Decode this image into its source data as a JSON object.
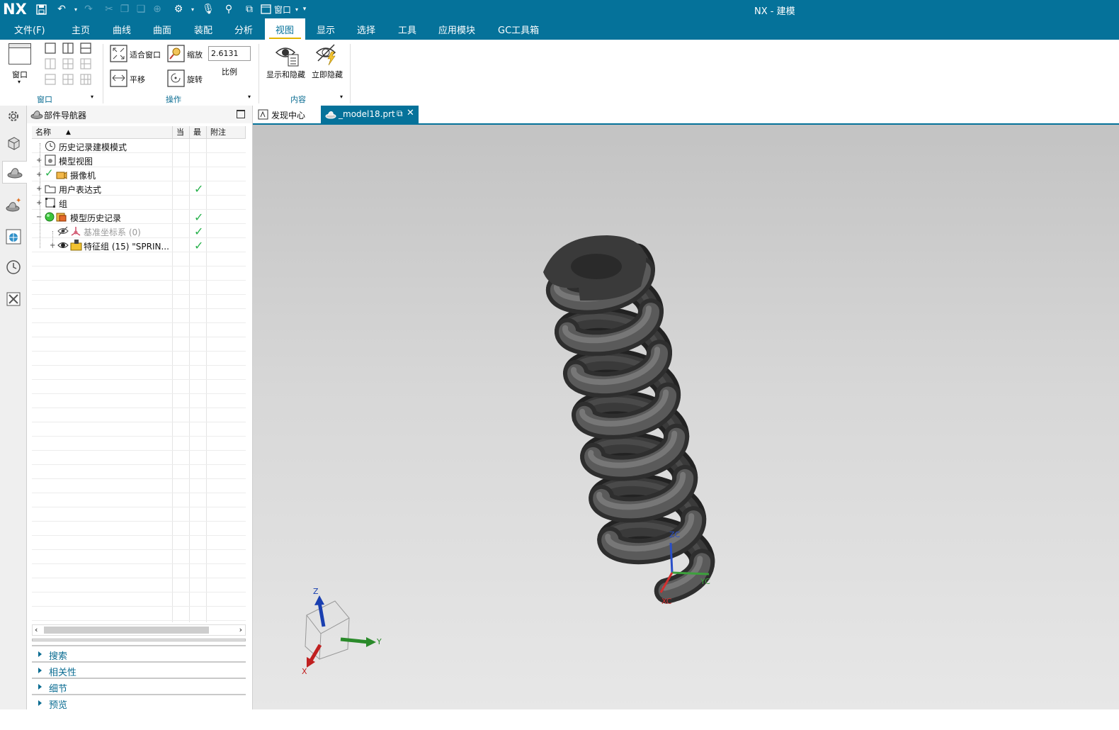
{
  "app": {
    "logo": "NX",
    "title": "NX - 建模",
    "window_menu_label": "窗口"
  },
  "menu": {
    "items": [
      "文件(F)",
      "主页",
      "曲线",
      "曲面",
      "装配",
      "分析",
      "视图",
      "显示",
      "选择",
      "工具",
      "应用模块",
      "GC工具箱"
    ],
    "active": "视图"
  },
  "ribbon": {
    "window_label": "窗口",
    "fit_label": "适合窗口",
    "zoom_label": "缩放",
    "zoom_value": "2.6131",
    "scale_label": "比例",
    "pan_label": "平移",
    "rotate_label": "旋转",
    "show_hide_label": "显示和隐藏",
    "instant_hide_label": "立即隐藏",
    "groups": {
      "window": "窗口",
      "operation": "操作",
      "content": "内容"
    }
  },
  "navigator": {
    "title": "部件导航器",
    "columns": {
      "name": "名称",
      "current": "当",
      "latest": "最",
      "notes": "附注"
    },
    "rows": [
      {
        "label": "历史记录建模模式",
        "checked": false
      },
      {
        "label": "模型视图",
        "checked": false
      },
      {
        "label": "摄像机",
        "checked": false
      },
      {
        "label": "用户表达式",
        "checked": true
      },
      {
        "label": "组",
        "checked": false
      },
      {
        "label": "模型历史记录",
        "checked": true
      },
      {
        "label": "基准坐标系 (0)",
        "checked": true
      },
      {
        "label": "特征组 (15) \"SPRIN...",
        "checked": true
      }
    ],
    "sections": [
      "搜索",
      "相关性",
      "细节",
      "预览"
    ]
  },
  "tabs": {
    "discovery": "发现中心",
    "model": "_model18.prt"
  },
  "triad": {
    "x": "X",
    "y": "Y",
    "z": "Z"
  },
  "wcs": {
    "xc": "XC",
    "yc": "YC",
    "zc": "ZC"
  },
  "colors": {
    "brand": "#05729a",
    "accent": "#e2b400",
    "check": "#27b14b",
    "spring": "#4a4a4a"
  }
}
